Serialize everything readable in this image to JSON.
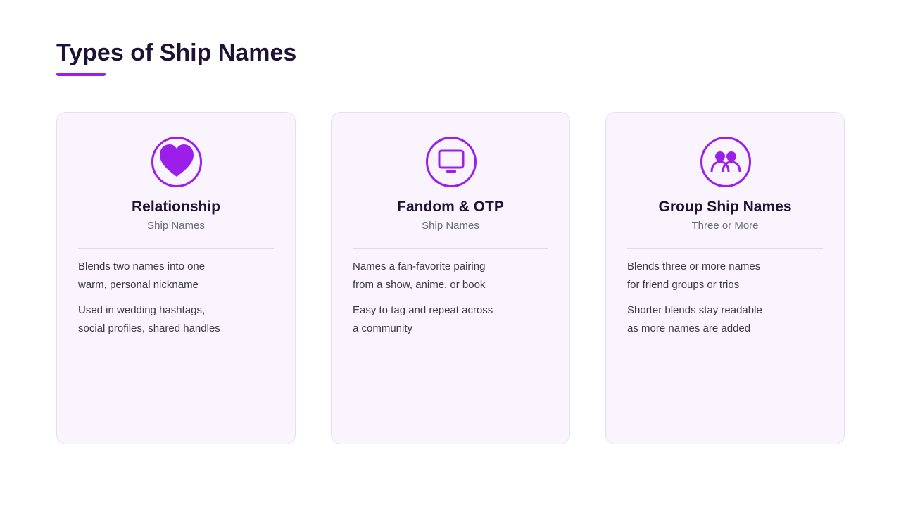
{
  "page": {
    "title": "Types of Ship Names",
    "accent_color": "#9b1fe8"
  },
  "cards": [
    {
      "icon": "heart-icon",
      "title": "Relationship",
      "subtitle": "Ship Names",
      "paragraphs": [
        [
          "Blends two names into one",
          "warm, personal nickname"
        ],
        [
          "Used in wedding hashtags,",
          "social profiles, shared handles"
        ]
      ]
    },
    {
      "icon": "tv-icon",
      "title": "Fandom & OTP",
      "subtitle": "Ship Names",
      "paragraphs": [
        [
          "Names a fan-favorite pairing",
          "from a show, anime, or book"
        ],
        [
          "Easy to tag and repeat across",
          "a community"
        ]
      ]
    },
    {
      "icon": "group-icon",
      "title": "Group Ship Names",
      "subtitle": "Three or More",
      "paragraphs": [
        [
          "Blends three or more names",
          "for friend groups or trios"
        ],
        [
          "Shorter blends stay readable",
          "as more names are added"
        ]
      ]
    }
  ]
}
